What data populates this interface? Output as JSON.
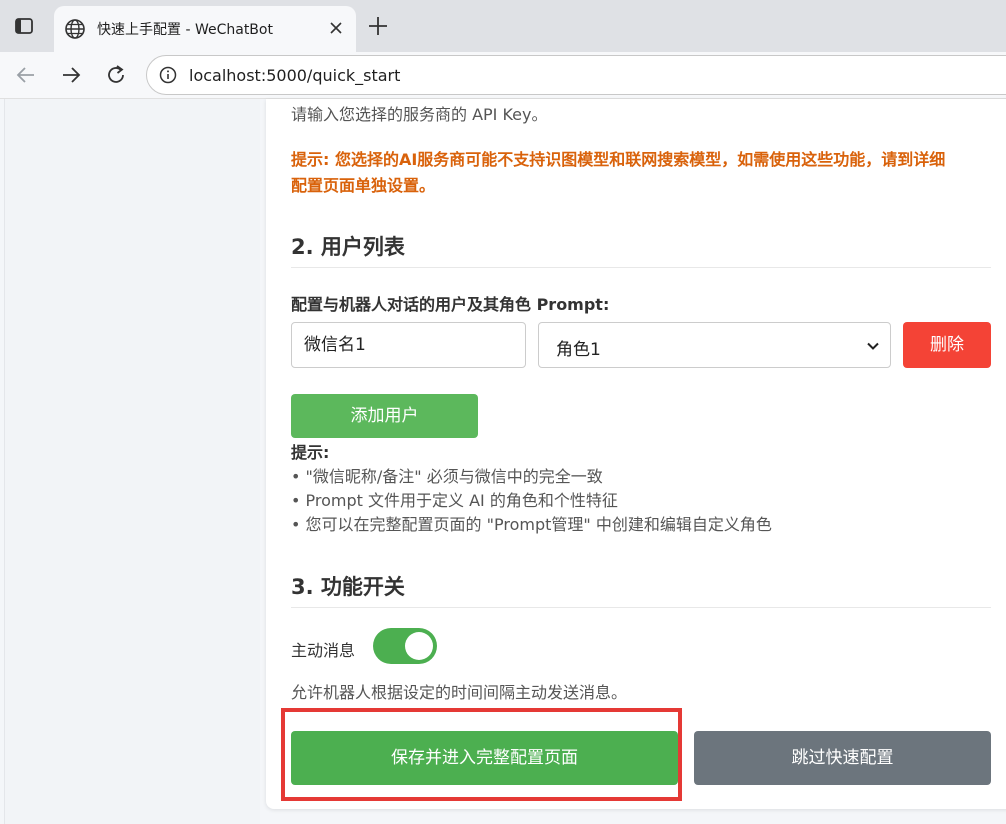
{
  "browser": {
    "tab_title": "快速上手配置 - WeChatBot",
    "url": "localhost:5000/quick_start"
  },
  "section_api": {
    "desc": "请输入您选择的服务商的 API Key。",
    "warning_line1": "提示: 您选择的AI服务商可能不支持识图模型和联网搜索模型，如需使用这些功能，请到详细",
    "warning_line2": "配置页面单独设置。"
  },
  "section_users": {
    "heading": "2. 用户列表",
    "label": "配置与机器人对话的用户及其角色 Prompt:",
    "user_row": {
      "name_value": "微信名1",
      "role_value": "角色1",
      "delete_label": "删除"
    },
    "add_user_label": "添加用户",
    "tips_title": "提示:",
    "tips": [
      "• \"微信昵称/备注\" 必须与微信中的完全一致",
      "• Prompt 文件用于定义 AI 的角色和个性特征",
      "• 您可以在完整配置页面的 \"Prompt管理\" 中创建和编辑自定义角色"
    ]
  },
  "section_features": {
    "heading": "3. 功能开关",
    "proactive_label": "主动消息",
    "proactive_enabled": true,
    "proactive_desc": "允许机器人根据设定的时间间隔主动发送消息。"
  },
  "actions": {
    "save_label": "保存并进入完整配置页面",
    "skip_label": "跳过快速配置"
  },
  "colors": {
    "warning": "#d9620b",
    "primary_green": "#4caf50",
    "delete_red": "#f44336",
    "skip_gray": "#6c757d",
    "highlight_red": "#e53935"
  }
}
